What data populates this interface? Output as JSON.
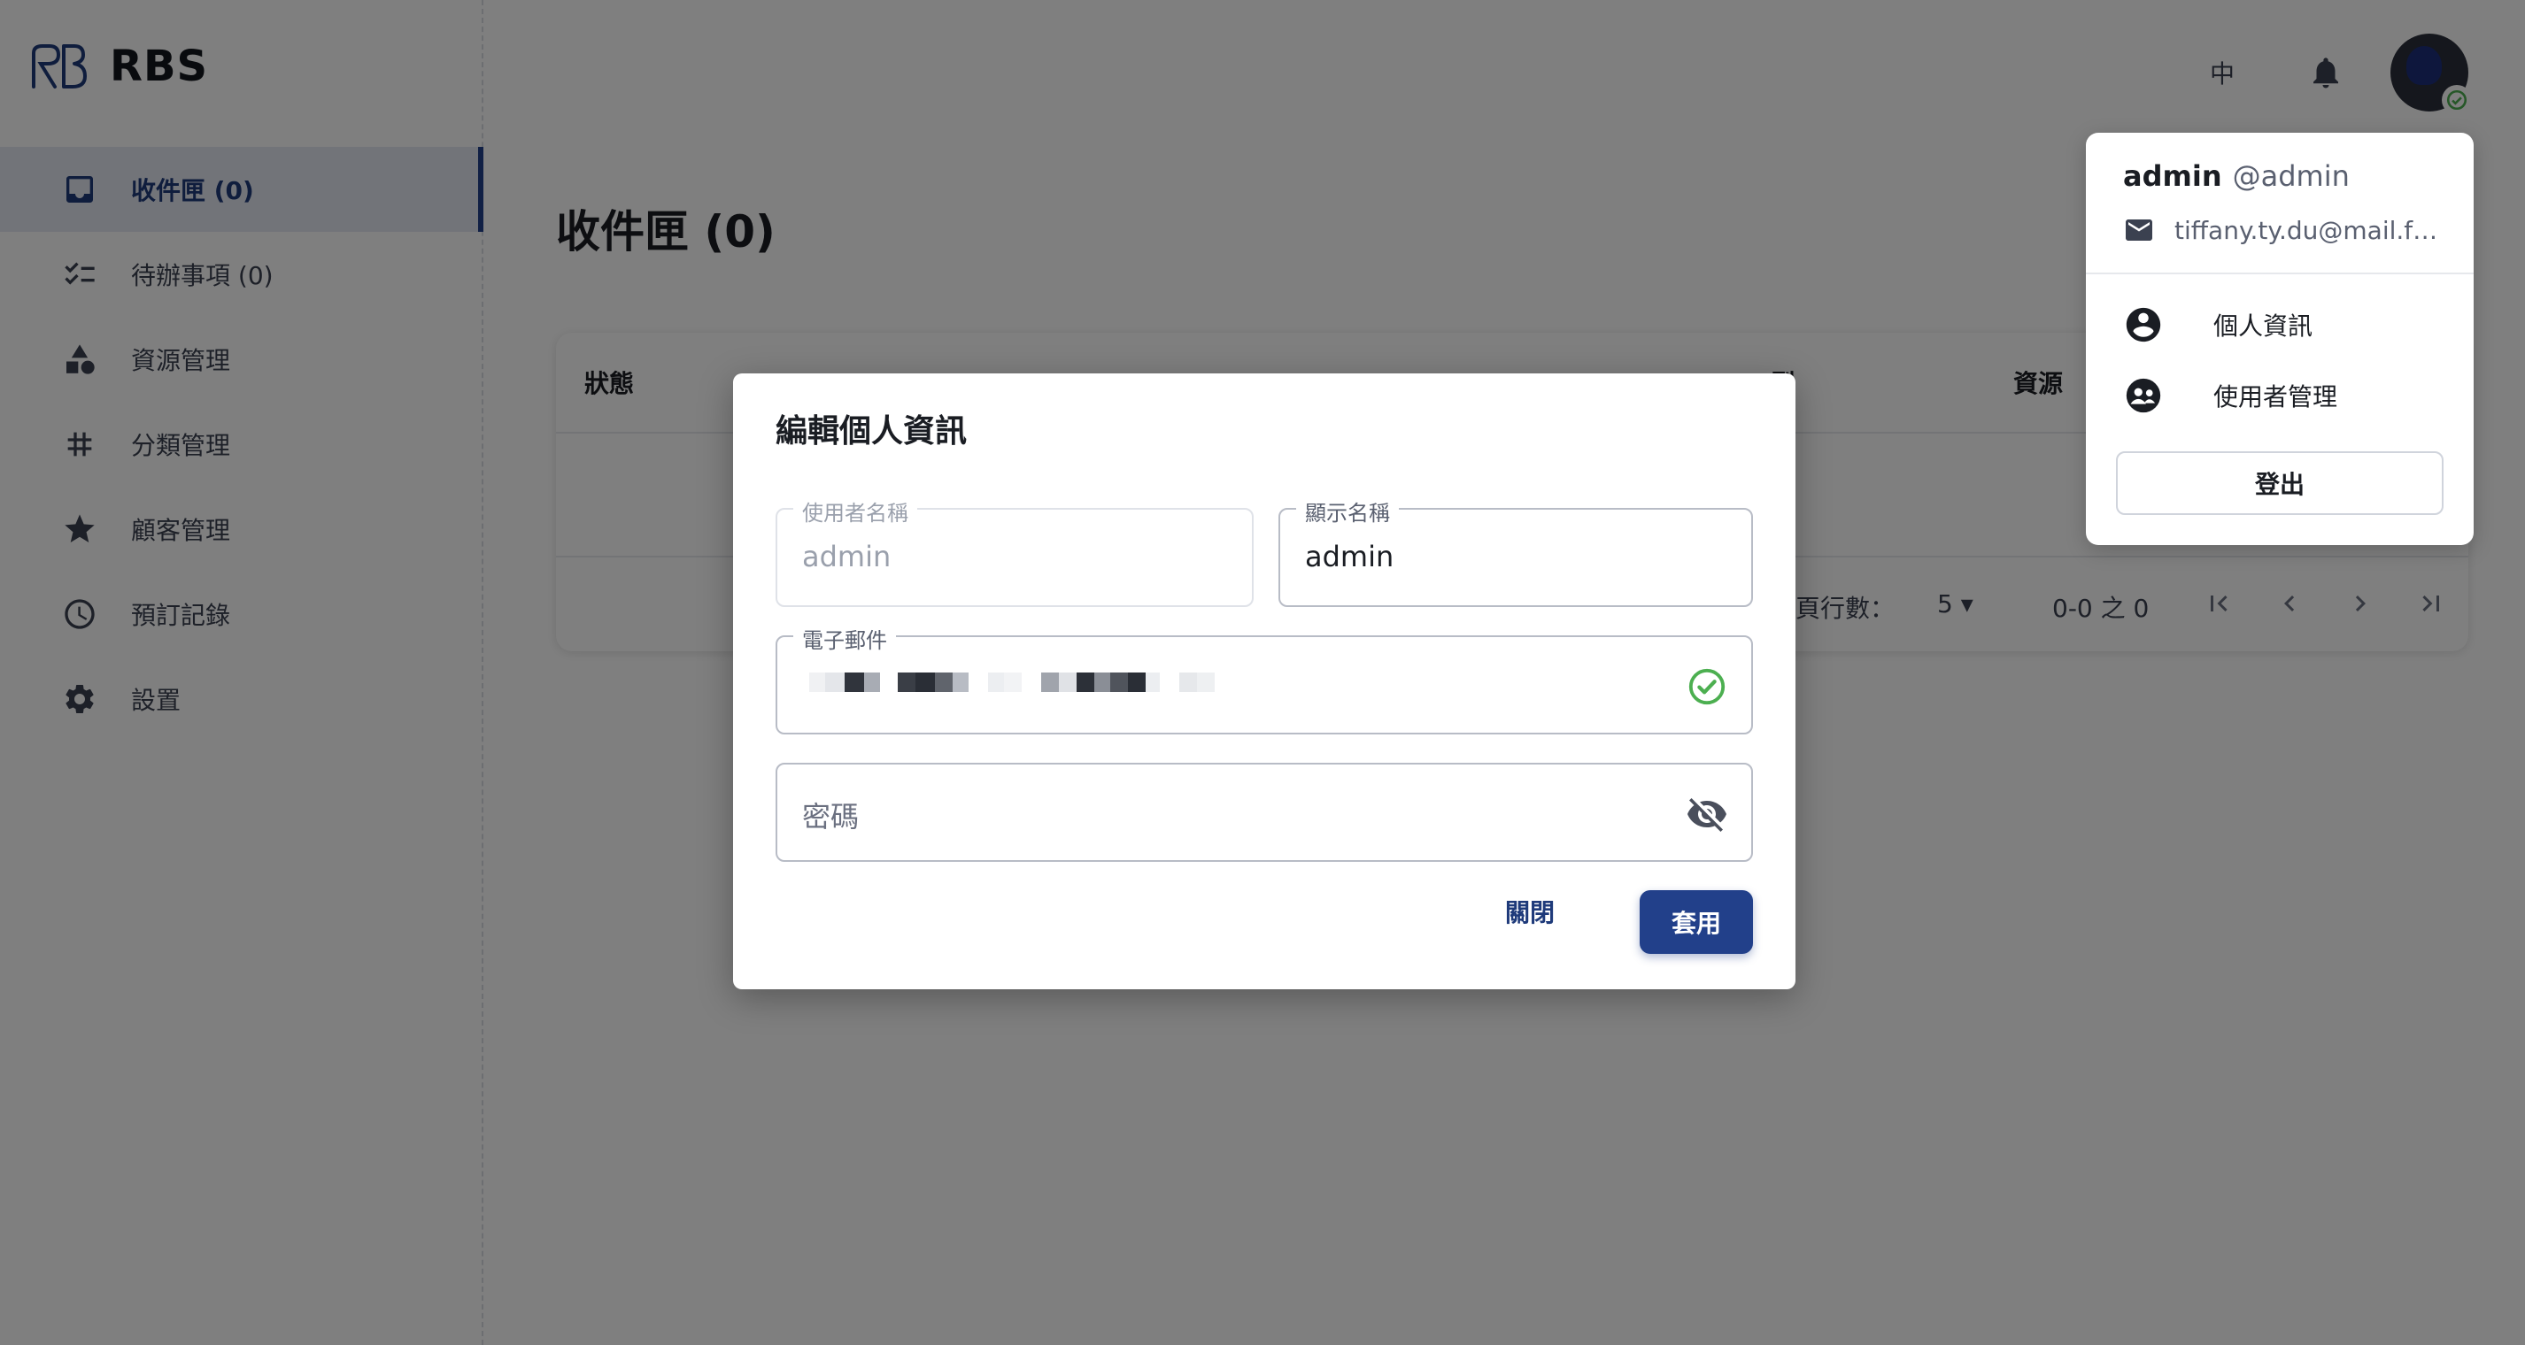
{
  "app": {
    "brand": "RBS"
  },
  "sidebar": {
    "items": [
      {
        "label": "收件匣 (0)",
        "icon": "inbox-icon",
        "active": true
      },
      {
        "label": "待辦事項 (0)",
        "icon": "checklist-icon"
      },
      {
        "label": "資源管理",
        "icon": "shapes-icon"
      },
      {
        "label": "分類管理",
        "icon": "hash-icon"
      },
      {
        "label": "顧客管理",
        "icon": "star-icon"
      },
      {
        "label": "預訂記錄",
        "icon": "clock-icon"
      },
      {
        "label": "設置",
        "icon": "gear-icon"
      }
    ]
  },
  "header": {
    "language": "中",
    "avatar_status": "online"
  },
  "main": {
    "title": "收件匣 (0)",
    "table": {
      "columns": [
        "狀態",
        "",
        "",
        "型",
        "資源"
      ],
      "rows_per_page_label": "每頁行數：",
      "rows_per_page_value": "5",
      "range": "0-0 之 0"
    }
  },
  "user_menu": {
    "name": "admin",
    "handle": "@admin",
    "email": "tiffany.ty.du@mail.fo...",
    "items": [
      {
        "label": "個人資訊",
        "icon": "account-circle-icon"
      },
      {
        "label": "使用者管理",
        "icon": "supervisor-account-icon"
      }
    ],
    "logout_label": "登出"
  },
  "modal": {
    "title": "編輯個人資訊",
    "username": {
      "label": "使用者名稱",
      "value": "admin"
    },
    "display_name": {
      "label": "顯示名稱",
      "value": "admin"
    },
    "email": {
      "label": "電子郵件"
    },
    "password": {
      "placeholder": "密碼"
    },
    "close_label": "關閉",
    "apply_label": "套用"
  },
  "colors": {
    "primary": "#22408a",
    "active_bg": "#e4e8f2",
    "success": "#4caf50",
    "overlay": "rgba(0,0,0,0.5)"
  }
}
